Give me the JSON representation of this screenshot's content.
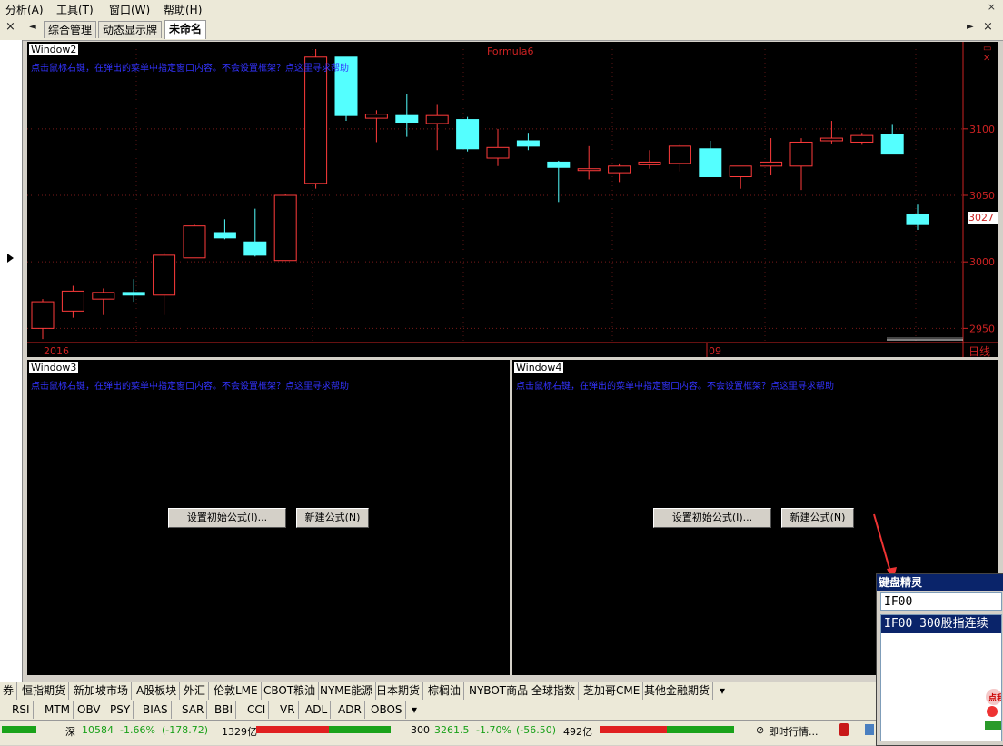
{
  "menu": {
    "items": [
      "分析(A)",
      "工具(T)",
      "窗口(W)",
      "帮助(H)"
    ],
    "close": "×"
  },
  "tabs": {
    "items": [
      "综合管理",
      "动态显示牌",
      "未命名"
    ],
    "active": 2,
    "prev": "◄",
    "next": "►",
    "close": "×"
  },
  "window2": {
    "title": "Window2",
    "formula": "Formula6",
    "hint": "点击鼠标右键，在弹出的菜单中指定窗口内容。不会设置框架？点这里寻求帮助",
    "x_labels": [
      "2016",
      "09"
    ],
    "period": "日线",
    "current_price": "3027"
  },
  "window3": {
    "title": "Window3",
    "hint": "点击鼠标右键，在弹出的菜单中指定窗口内容。不会设置框架？点这里寻求帮助",
    "btn_initial": "设置初始公式(I)...",
    "btn_new": "新建公式(N)"
  },
  "window4": {
    "title": "Window4",
    "hint": "点击鼠标右键，在弹出的菜单中指定窗口内容。不会设置框架？点这里寻求帮助",
    "btn_initial": "设置初始公式(I)...",
    "btn_new": "新建公式(N)"
  },
  "market_tabs": [
    "券",
    "恒指期货",
    "新加坡市场",
    "A股板块",
    "外汇",
    "伦敦LME",
    "CBOT粮油",
    "NYME能源",
    "日本期货",
    "棕榈油",
    "NYBOT商品",
    "全球指数",
    "芝加哥CME",
    "其他金融期货"
  ],
  "indicator_tabs": [
    "RSI",
    "MTM",
    "OBV",
    "PSY",
    "BIAS",
    "SAR",
    "BBI",
    "CCI",
    "VR",
    "ADL",
    "ADR",
    "OBOS"
  ],
  "status": {
    "sz_label": "深",
    "sz_value": "10584",
    "sz_change": "-1.66%",
    "sz_points": "(-178.72)",
    "sz_volume": "1329亿",
    "hs_label": "300",
    "hs_value": "3261.5",
    "hs_change": "-1.70%",
    "hs_points": "(-56.50)",
    "hs_volume": "492亿",
    "realtime": "即时行情..."
  },
  "keyboard_wizard": {
    "title": "键盘精灵",
    "input": "IF00",
    "result": "IF00 300股指连续",
    "ad": "点我"
  },
  "colors": {
    "up": "#ff3b3b",
    "down": "#54ffff",
    "axis": "#cc2222",
    "hint": "#3333ff",
    "title_bar": "#0a246a"
  },
  "chart_data": {
    "type": "candlestick",
    "title": "",
    "ylim": [
      2940,
      3160
    ],
    "yticks": [
      2950,
      3000,
      3050,
      3100
    ],
    "ohlc": [
      [
        2950,
        2970,
        2942,
        2972
      ],
      [
        2963,
        2978,
        2958,
        2982
      ],
      [
        2972,
        2977,
        2960,
        2980
      ],
      [
        2977,
        2975,
        2970,
        2987
      ],
      [
        2975,
        3005,
        2960,
        3007
      ],
      [
        3003,
        3027,
        3003,
        3028
      ],
      [
        3022,
        3018,
        3017,
        3032
      ],
      [
        3015,
        3005,
        3004,
        3040
      ],
      [
        3001,
        3050,
        3001,
        3051
      ],
      [
        3059,
        3154,
        3055,
        3160
      ],
      [
        3154,
        3110,
        3106,
        3154
      ],
      [
        3108,
        3111,
        3090,
        3114
      ],
      [
        3110,
        3105,
        3094,
        3126
      ],
      [
        3104,
        3110,
        3084,
        3118
      ],
      [
        3107,
        3085,
        3083,
        3109
      ],
      [
        3078,
        3086,
        3072,
        3100
      ],
      [
        3091,
        3087,
        3084,
        3097
      ],
      [
        3075,
        3071,
        3045,
        3076
      ],
      [
        3069,
        3070,
        3062,
        3087
      ],
      [
        3067,
        3072,
        3060,
        3074
      ],
      [
        3073,
        3075,
        3070,
        3084
      ],
      [
        3074,
        3087,
        3068,
        3089
      ],
      [
        3085,
        3064,
        3064,
        3091
      ],
      [
        3064,
        3072,
        3055,
        3072
      ],
      [
        3072,
        3075,
        3065,
        3093
      ],
      [
        3072,
        3090,
        3054,
        3093
      ],
      [
        3091,
        3093,
        3089,
        3106
      ],
      [
        3090,
        3095,
        3088,
        3097
      ],
      [
        3096,
        3081,
        3081,
        3103
      ],
      [
        3036,
        3028,
        3024,
        3043
      ]
    ]
  }
}
